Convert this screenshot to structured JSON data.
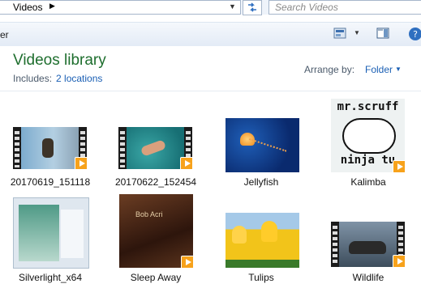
{
  "address": {
    "breadcrumb": "Videos",
    "search_placeholder": "Search Videos"
  },
  "toolbar": {
    "partial_text": "er"
  },
  "library": {
    "title": "Videos library",
    "includes_label": "Includes:",
    "locations_link": "2 locations",
    "arrange_label": "Arrange by:",
    "arrange_value": "Folder"
  },
  "items": [
    {
      "name": "20170619_151118"
    },
    {
      "name": "20170622_152454"
    },
    {
      "name": "Jellyfish"
    },
    {
      "name": "Kalimba"
    },
    {
      "name": "Silverlight_x64"
    },
    {
      "name": "Sleep Away"
    },
    {
      "name": "Tulips"
    },
    {
      "name": "Wildlife"
    }
  ],
  "thumb_text": {
    "kalimba_top": "mr.scruff",
    "kalimba_bottom": "ninja tu",
    "sleepaway_text": "Bob Acri"
  },
  "colors": {
    "title_green": "#1e6e2e",
    "link_blue": "#1a5fb4",
    "play_orange": "#f7a21b"
  }
}
